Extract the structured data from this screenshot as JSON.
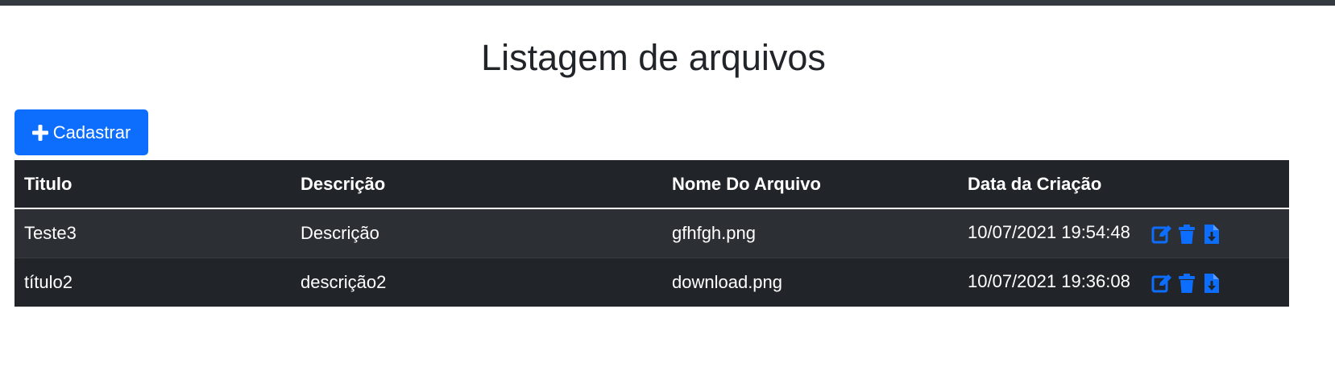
{
  "page": {
    "title": "Listagem de arquivos"
  },
  "toolbar": {
    "create_label": "Cadastrar",
    "create_icon": "plus-icon"
  },
  "table": {
    "headers": [
      "Titulo",
      "Descrição",
      "Nome Do Arquivo",
      "Data da Criação"
    ],
    "rows": [
      {
        "titulo": "Teste3",
        "descricao": "Descrição",
        "arquivo": "gfhfgh.png",
        "data": "10/07/2021 19:54:48",
        "actions": [
          "edit-icon",
          "trash-icon",
          "file-download-icon"
        ]
      },
      {
        "titulo": "título2",
        "descricao": "descrição2",
        "arquivo": "download.png",
        "data": "10/07/2021 19:36:08",
        "actions": [
          "edit-icon",
          "trash-icon",
          "file-download-icon"
        ]
      }
    ]
  },
  "colors": {
    "primary": "#0d6efd",
    "table_dark": "#212529",
    "table_striped": "#2c3034",
    "top_bar": "#343a40"
  }
}
